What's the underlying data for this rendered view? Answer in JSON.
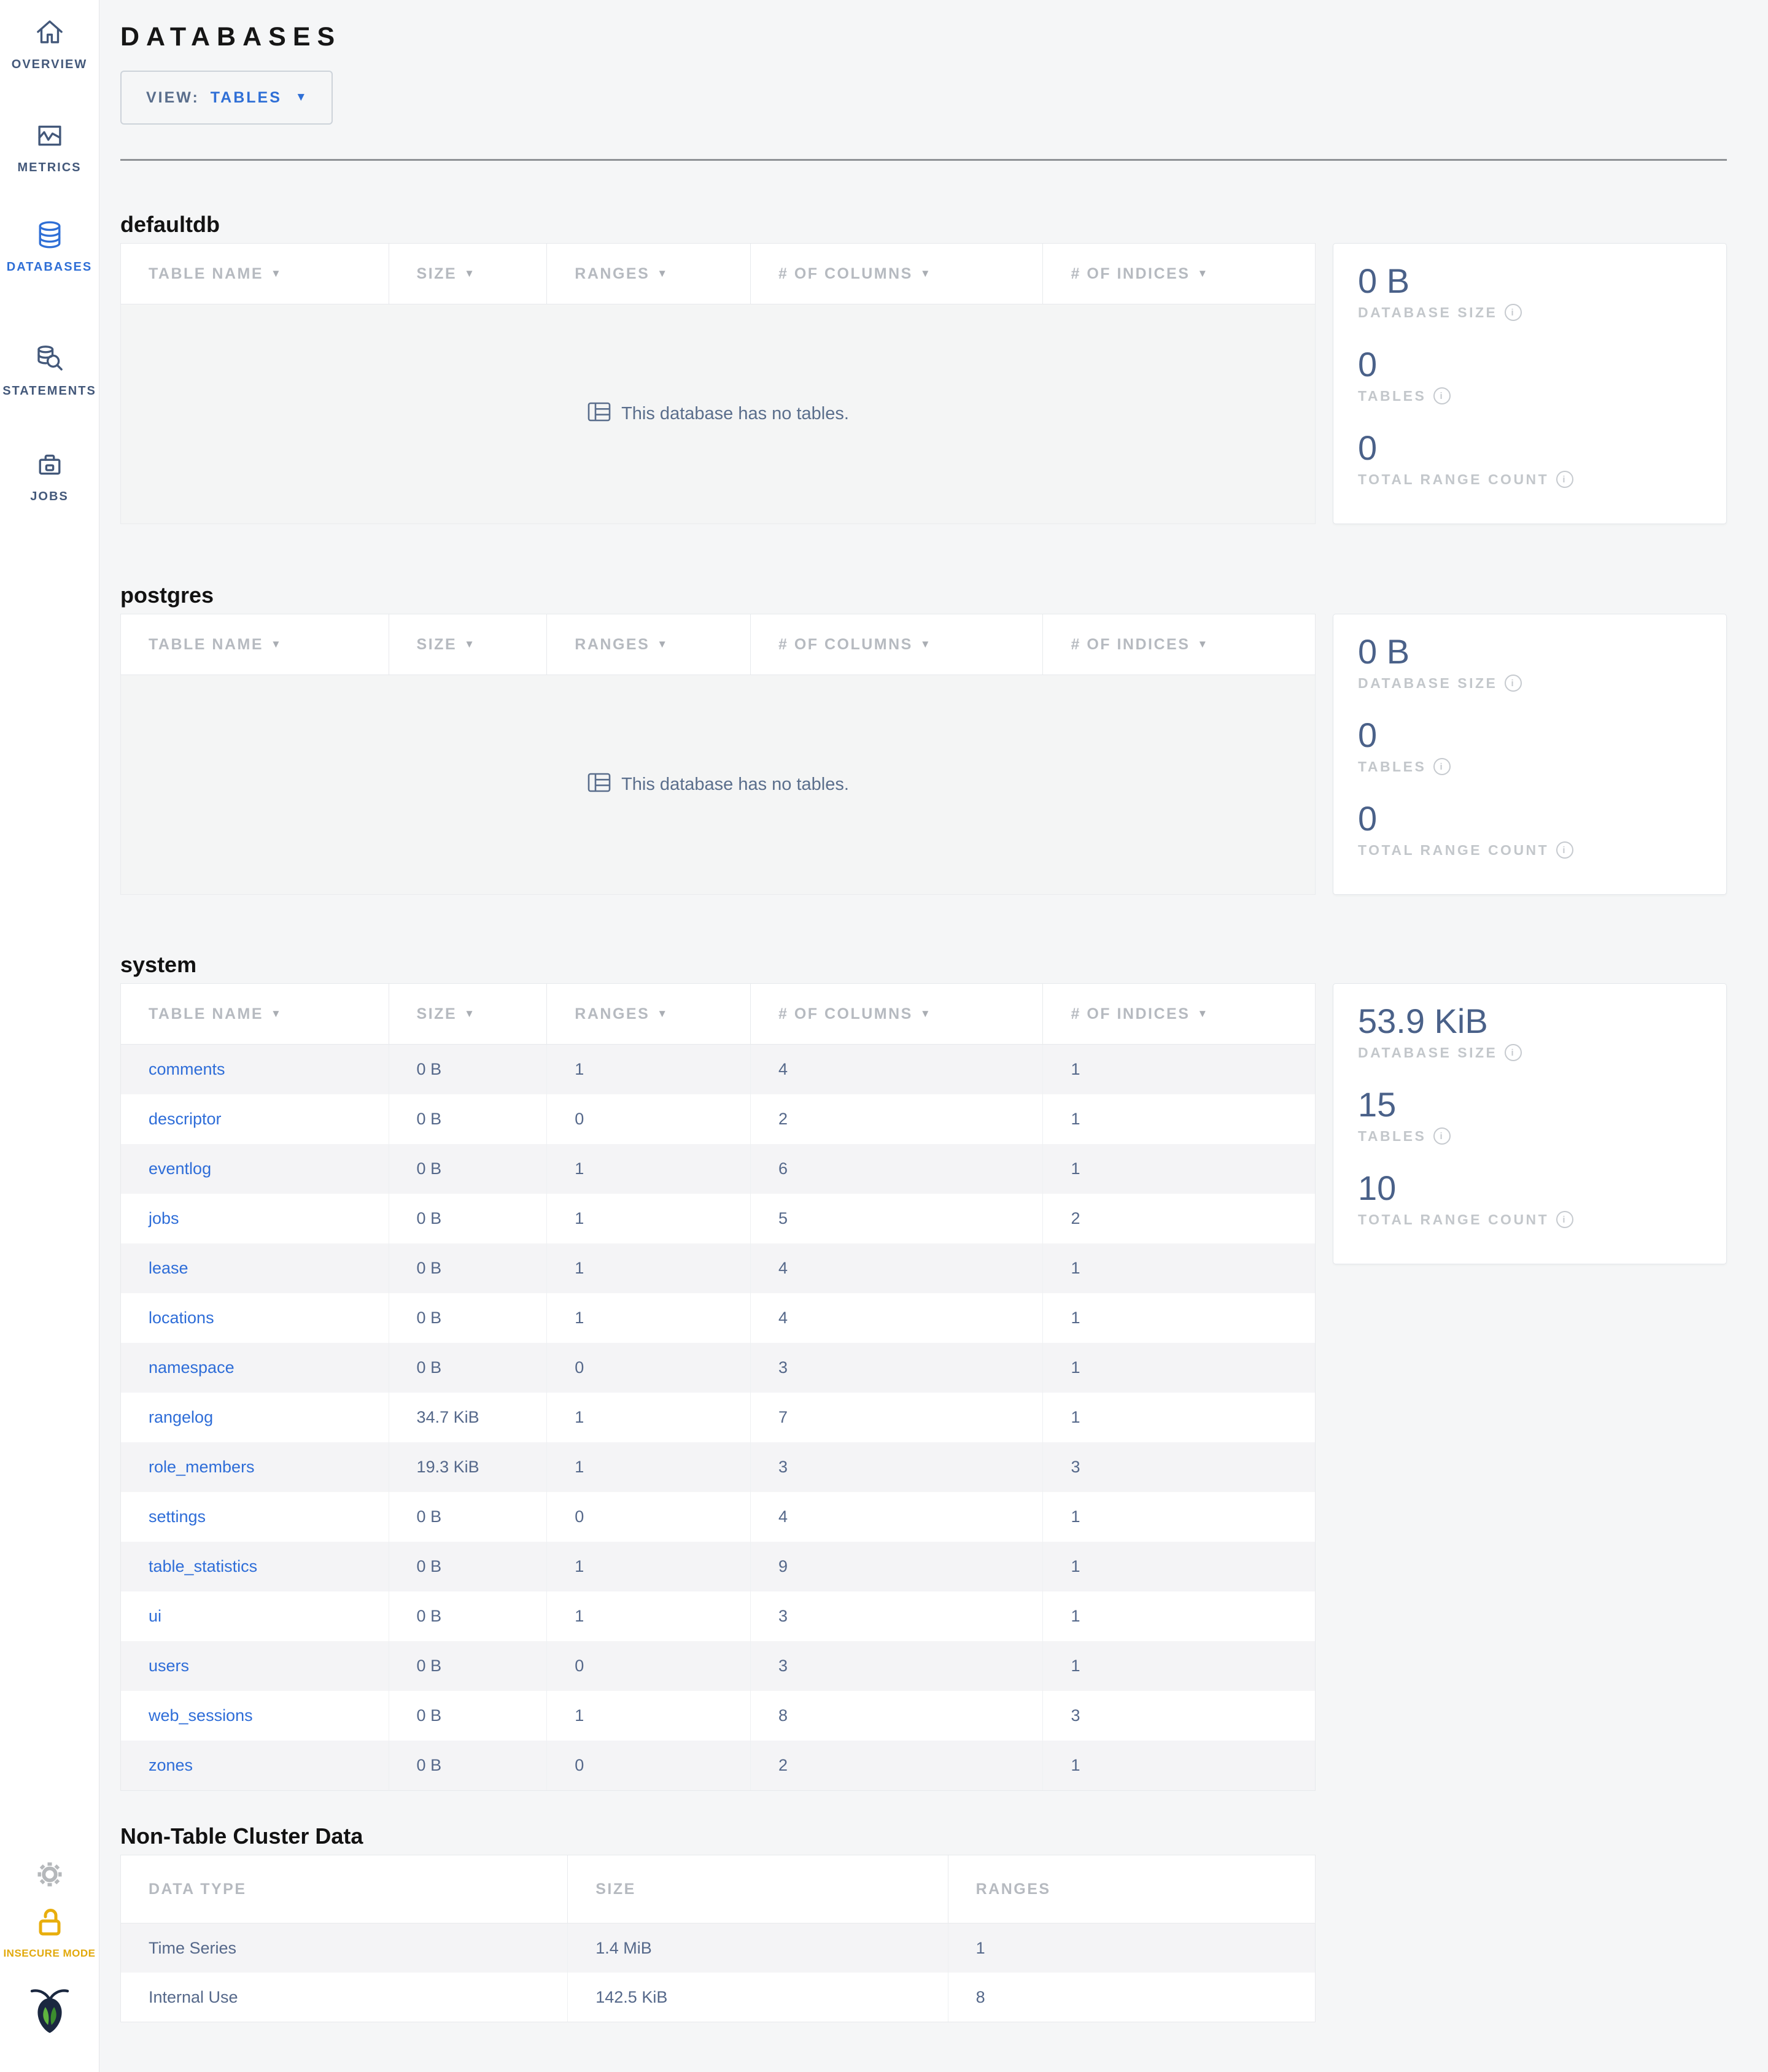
{
  "sidebar": {
    "items": [
      {
        "label": "OVERVIEW",
        "icon": "home-icon",
        "active": false
      },
      {
        "label": "METRICS",
        "icon": "metrics-icon",
        "active": false
      },
      {
        "label": "DATABASES",
        "icon": "database-icon",
        "active": true
      },
      {
        "label": "STATEMENTS",
        "icon": "statements-icon",
        "active": false
      },
      {
        "label": "JOBS",
        "icon": "jobs-icon",
        "active": false
      }
    ],
    "insecure_label": "INSECURE MODE"
  },
  "header": {
    "title": "DATABASES",
    "view_label": "VIEW:",
    "view_value": "TABLES"
  },
  "table_headers": {
    "name": "TABLE NAME",
    "size": "SIZE",
    "ranges": "RANGES",
    "columns": "# OF COLUMNS",
    "indices": "# OF INDICES"
  },
  "empty_message": "This database has no tables.",
  "stat_labels": {
    "size": "DATABASE SIZE",
    "tables": "TABLES",
    "ranges": "TOTAL RANGE COUNT"
  },
  "databases": [
    {
      "name": "defaultdb",
      "stats": {
        "size": "0 B",
        "tables": "0",
        "ranges": "0"
      },
      "rows": []
    },
    {
      "name": "postgres",
      "stats": {
        "size": "0 B",
        "tables": "0",
        "ranges": "0"
      },
      "rows": []
    },
    {
      "name": "system",
      "stats": {
        "size": "53.9 KiB",
        "tables": "15",
        "ranges": "10"
      },
      "rows": [
        [
          "comments",
          "0 B",
          "1",
          "4",
          "1"
        ],
        [
          "descriptor",
          "0 B",
          "0",
          "2",
          "1"
        ],
        [
          "eventlog",
          "0 B",
          "1",
          "6",
          "1"
        ],
        [
          "jobs",
          "0 B",
          "1",
          "5",
          "2"
        ],
        [
          "lease",
          "0 B",
          "1",
          "4",
          "1"
        ],
        [
          "locations",
          "0 B",
          "1",
          "4",
          "1"
        ],
        [
          "namespace",
          "0 B",
          "0",
          "3",
          "1"
        ],
        [
          "rangelog",
          "34.7 KiB",
          "1",
          "7",
          "1"
        ],
        [
          "role_members",
          "19.3 KiB",
          "1",
          "3",
          "3"
        ],
        [
          "settings",
          "0 B",
          "0",
          "4",
          "1"
        ],
        [
          "table_statistics",
          "0 B",
          "1",
          "9",
          "1"
        ],
        [
          "ui",
          "0 B",
          "1",
          "3",
          "1"
        ],
        [
          "users",
          "0 B",
          "0",
          "3",
          "1"
        ],
        [
          "web_sessions",
          "0 B",
          "1",
          "8",
          "3"
        ],
        [
          "zones",
          "0 B",
          "0",
          "2",
          "1"
        ]
      ]
    }
  ],
  "non_table": {
    "title": "Non-Table Cluster Data",
    "headers": {
      "type": "DATA TYPE",
      "size": "SIZE",
      "ranges": "RANGES"
    },
    "rows": [
      [
        "Time Series",
        "1.4 MiB",
        "1"
      ],
      [
        "Internal Use",
        "142.5 KiB",
        "8"
      ]
    ]
  },
  "colors": {
    "accent_blue": "#2f6fd6",
    "link_blue": "#2e6dd8",
    "slate_text": "#55688a",
    "stat_value": "#4a6189",
    "insecure_yellow": "#e2a90c",
    "logo_navy": "#1b2840",
    "leaf_light": "#5fb53f",
    "leaf_dark": "#3c8e2e"
  }
}
